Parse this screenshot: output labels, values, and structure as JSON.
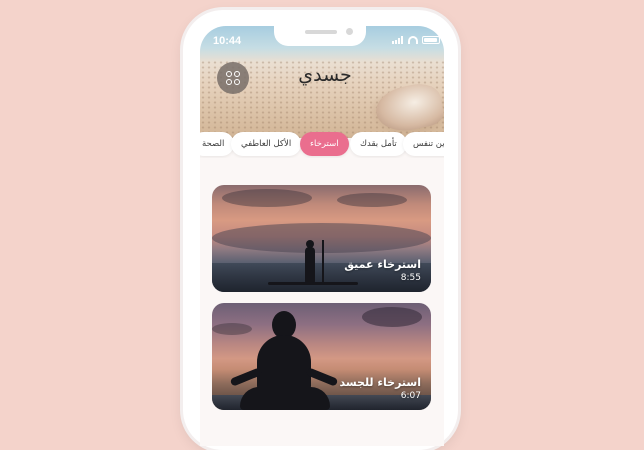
{
  "status_bar": {
    "time": "10:44"
  },
  "header": {
    "title": "جسدي",
    "menu_icon": "apps-grid-icon"
  },
  "categories": [
    {
      "label": "الصحة",
      "active": false
    },
    {
      "label": "الأكل العاطفي",
      "active": false
    },
    {
      "label": "استرخاء",
      "active": true
    },
    {
      "label": "تأمل بقدك",
      "active": false
    },
    {
      "label": "تمارين تنفس",
      "active": false
    }
  ],
  "sessions": [
    {
      "title": "استرخاء عميق",
      "duration": "8:55"
    },
    {
      "title": "استرخاء للجسد",
      "duration": "6:07"
    }
  ],
  "colors": {
    "background": "#f4d3cb",
    "accent": "#ea6e8e"
  }
}
